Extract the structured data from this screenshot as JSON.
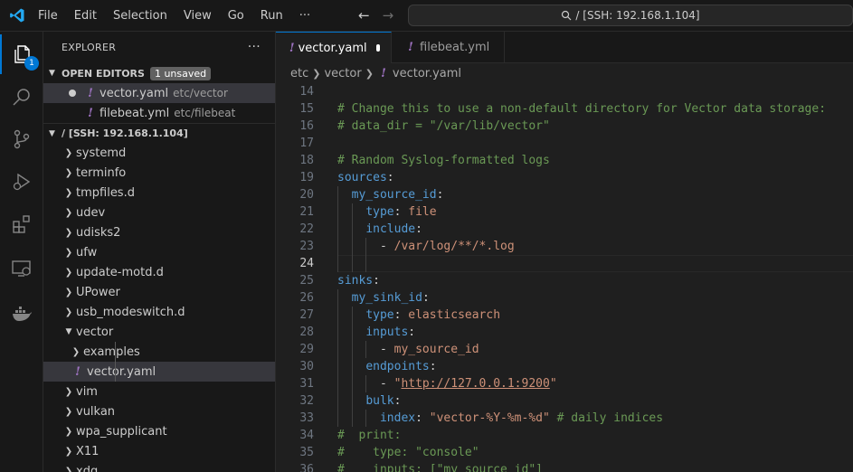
{
  "titlebar": {
    "menu": [
      "File",
      "Edit",
      "Selection",
      "View",
      "Go",
      "Run",
      "···"
    ],
    "command_center": "/ [SSH: 192.168.1.104]"
  },
  "activity": {
    "explorer_badge": "1"
  },
  "sidebar": {
    "header": "EXPLORER",
    "open_editors": {
      "title": "OPEN EDITORS",
      "badge": "1 unsaved",
      "items": [
        {
          "name": "vector.yaml",
          "desc": "etc/vector"
        },
        {
          "name": "filebeat.yml",
          "desc": "etc/filebeat"
        }
      ]
    },
    "root": {
      "title": "/ [SSH: 192.168.1.104]"
    },
    "tree": [
      {
        "label": "systemd"
      },
      {
        "label": "terminfo"
      },
      {
        "label": "tmpfiles.d"
      },
      {
        "label": "udev"
      },
      {
        "label": "udisks2"
      },
      {
        "label": "ufw"
      },
      {
        "label": "update-motd.d"
      },
      {
        "label": "UPower"
      },
      {
        "label": "usb_modeswitch.d"
      },
      {
        "label": "vector"
      },
      {
        "label": "examples"
      },
      {
        "label": "vector.yaml"
      },
      {
        "label": "vim"
      },
      {
        "label": "vulkan"
      },
      {
        "label": "wpa_supplicant"
      },
      {
        "label": "X11"
      },
      {
        "label": "xdg"
      }
    ]
  },
  "editor": {
    "tabs": [
      {
        "label": "vector.yaml"
      },
      {
        "label": "filebeat.yml"
      }
    ],
    "breadcrumb": [
      "etc",
      "vector",
      "vector.yaml"
    ],
    "lines": [
      {
        "n": "14",
        "tokens": []
      },
      {
        "n": "15",
        "tokens": [
          [
            "c",
            "# Change this to use a non-default directory for Vector data storage:"
          ]
        ]
      },
      {
        "n": "16",
        "tokens": [
          [
            "c",
            "# data_dir = \"/var/lib/vector\""
          ]
        ]
      },
      {
        "n": "17",
        "tokens": []
      },
      {
        "n": "18",
        "tokens": [
          [
            "c",
            "# Random Syslog-formatted logs"
          ]
        ]
      },
      {
        "n": "19",
        "tokens": [
          [
            "k",
            "sources"
          ],
          [
            "p",
            ":"
          ]
        ]
      },
      {
        "n": "20",
        "tokens": [
          [
            "p",
            "  "
          ],
          [
            "k",
            "my_source_id"
          ],
          [
            "p",
            ":"
          ]
        ]
      },
      {
        "n": "21",
        "tokens": [
          [
            "p",
            "    "
          ],
          [
            "k",
            "type"
          ],
          [
            "p",
            ": "
          ],
          [
            "s",
            "file"
          ]
        ]
      },
      {
        "n": "22",
        "tokens": [
          [
            "p",
            "    "
          ],
          [
            "k",
            "include"
          ],
          [
            "p",
            ":"
          ]
        ]
      },
      {
        "n": "23",
        "tokens": [
          [
            "p",
            "      - "
          ],
          [
            "s",
            "/var/log/**/*.log"
          ]
        ]
      },
      {
        "n": "24",
        "tokens": []
      },
      {
        "n": "25",
        "tokens": [
          [
            "k",
            "sinks"
          ],
          [
            "p",
            ":"
          ]
        ]
      },
      {
        "n": "26",
        "tokens": [
          [
            "p",
            "  "
          ],
          [
            "k",
            "my_sink_id"
          ],
          [
            "p",
            ":"
          ]
        ]
      },
      {
        "n": "27",
        "tokens": [
          [
            "p",
            "    "
          ],
          [
            "k",
            "type"
          ],
          [
            "p",
            ": "
          ],
          [
            "s",
            "elasticsearch"
          ]
        ]
      },
      {
        "n": "28",
        "tokens": [
          [
            "p",
            "    "
          ],
          [
            "k",
            "inputs"
          ],
          [
            "p",
            ":"
          ]
        ]
      },
      {
        "n": "29",
        "tokens": [
          [
            "p",
            "      - "
          ],
          [
            "s",
            "my_source_id"
          ]
        ]
      },
      {
        "n": "30",
        "tokens": [
          [
            "p",
            "    "
          ],
          [
            "k",
            "endpoints"
          ],
          [
            "p",
            ":"
          ]
        ]
      },
      {
        "n": "31",
        "tokens": [
          [
            "p",
            "      - "
          ],
          [
            "s",
            "\""
          ],
          [
            "u",
            "http://127.0.0.1:9200"
          ],
          [
            "s",
            "\""
          ]
        ]
      },
      {
        "n": "32",
        "tokens": [
          [
            "p",
            "    "
          ],
          [
            "k",
            "bulk"
          ],
          [
            "p",
            ":"
          ]
        ]
      },
      {
        "n": "33",
        "tokens": [
          [
            "p",
            "      "
          ],
          [
            "k",
            "index"
          ],
          [
            "p",
            ": "
          ],
          [
            "s",
            "\"vector-%Y-%m-%d\""
          ],
          [
            "p",
            " "
          ],
          [
            "c",
            "# daily indices"
          ]
        ]
      },
      {
        "n": "34",
        "tokens": [
          [
            "c",
            "#  print:"
          ]
        ]
      },
      {
        "n": "35",
        "tokens": [
          [
            "c",
            "#    type: \"console\""
          ]
        ]
      },
      {
        "n": "36",
        "tokens": [
          [
            "c",
            "#    inputs: [\"my_source_id\"]"
          ]
        ]
      }
    ]
  },
  "colors": {
    "accent": "#0078d4",
    "yaml_icon": "#a074c4",
    "comment": "#6a9955",
    "key": "#569cd6",
    "string": "#ce9178"
  }
}
